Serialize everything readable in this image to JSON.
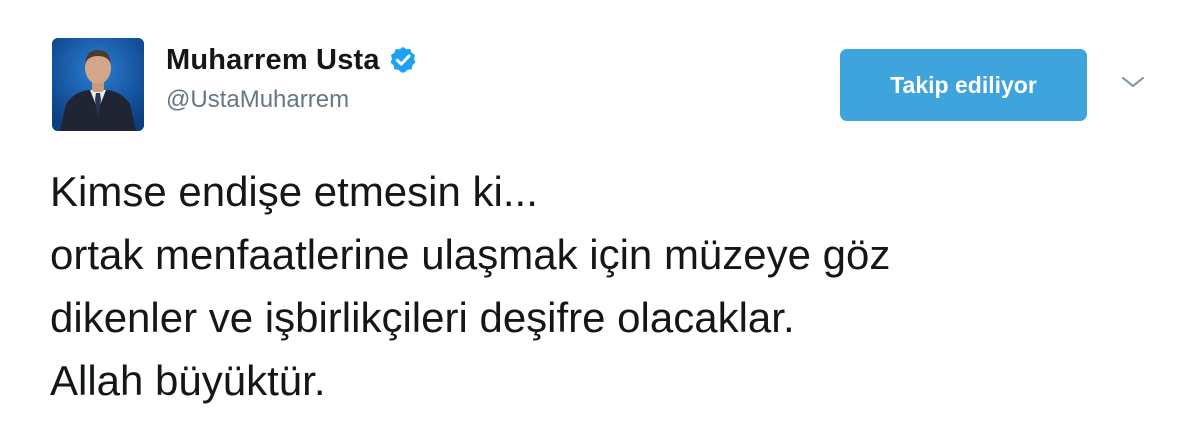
{
  "user": {
    "display_name": "Muharrem Usta",
    "handle": "@UstaMuharrem",
    "verified": true
  },
  "actions": {
    "follow_label": "Takip ediliyor"
  },
  "tweet": {
    "lines": [
      "Kimse endişe etmesin ki...",
      "ortak menfaatlerine ulaşmak için müzeye göz",
      "dikenler ve işbirlikçileri deşifre olacaklar.",
      "Allah büyüktür."
    ]
  },
  "icons": {
    "verified": "verified-badge-icon",
    "menu": "chevron-down-icon"
  },
  "colors": {
    "follow_button": "#3fa3dc",
    "verified_badge": "#1da1f2",
    "handle_text": "#657786",
    "tweet_text": "#14171a"
  }
}
